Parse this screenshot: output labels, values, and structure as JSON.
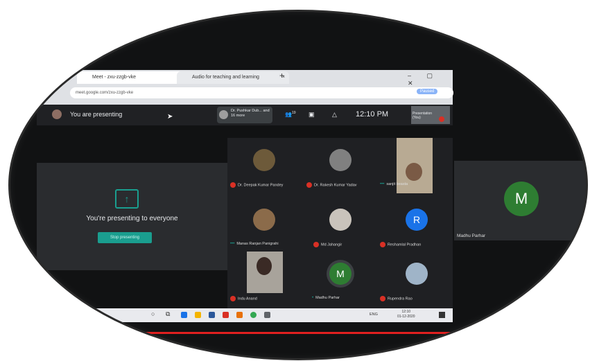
{
  "browser": {
    "tabs": [
      "Meet - zxu-zzgb-vke",
      "Audio for teaching and learning"
    ],
    "new_tab": "+",
    "url": "meet.google.com/zxu-zzgb-vke",
    "profile": "Paused"
  },
  "meet_header": {
    "presenting_label": "You are presenting",
    "host_chip": "Dr. Pushkar Dub... and 16 more",
    "participants_count": "19",
    "time": "12:10 PM",
    "presentation_label": "Presentation (You)"
  },
  "presenting_panel": {
    "message": "You're presenting to everyone",
    "stop_button": "Stop presenting"
  },
  "participants": [
    {
      "name": "Dr. Deepak Kumar Pandey",
      "muted": true
    },
    {
      "name": "Dr. Rakesh Kumar Yadav",
      "muted": true
    },
    {
      "name": "sanjit beasta",
      "muted": false
    },
    {
      "name": "Manas Ranjan Panigrahi",
      "muted": false
    },
    {
      "name": "Md Jahangir",
      "muted": true
    },
    {
      "name": "Reshamlal Pradhan",
      "muted": true,
      "initial": "R"
    },
    {
      "name": "Indu Anand",
      "muted": true
    },
    {
      "name": "Madhu Parhar",
      "muted": false,
      "initial": "M"
    },
    {
      "name": "Rupendra Rao",
      "muted": true
    }
  ],
  "side_participant": {
    "name": "Madhu Parhar",
    "initial": "M"
  },
  "taskbar": {
    "lang": "ENG",
    "time": "12:10",
    "date": "01-12-2020"
  },
  "colors": {
    "meet_dark": "#202124",
    "accent_teal": "#1a9e8f",
    "green_avatar": "#2e7d32",
    "blue_avatar": "#1a73e8",
    "mute_red": "#d93025"
  }
}
